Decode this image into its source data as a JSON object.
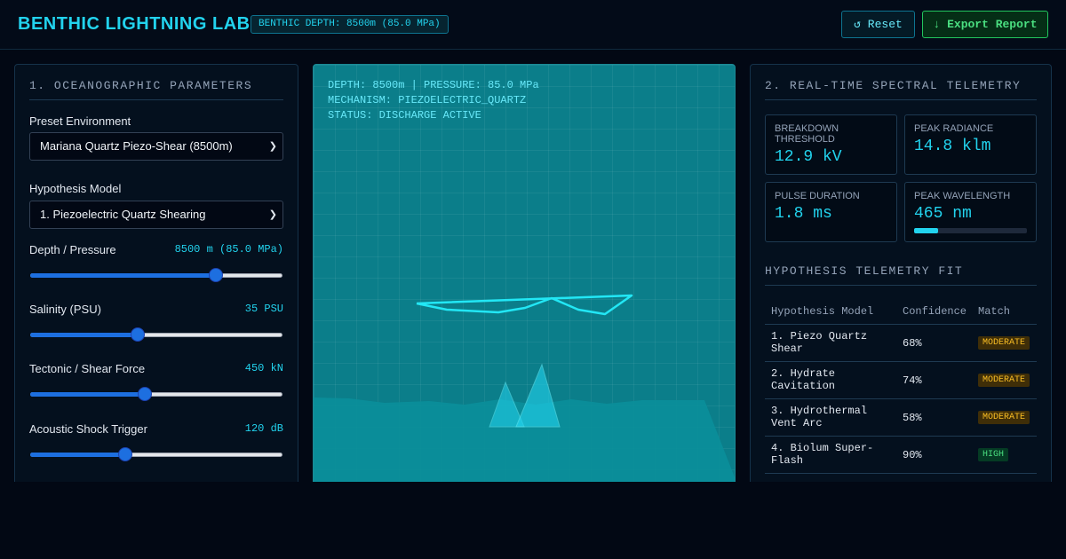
{
  "header": {
    "title": "BENTHIC LIGHTNING LAB",
    "depth_badge": "BENTHIC DEPTH: 8500m (85.0 MPa)",
    "reset_label": "↺ Reset",
    "export_label": "↓ Export Report"
  },
  "left_panel": {
    "heading": "1. OCEANOGRAPHIC PARAMETERS",
    "preset_label": "Preset Environment",
    "preset_value": "Mariana Quartz Piezo-Shear (8500m)",
    "hypothesis_label": "Hypothesis Model",
    "hypothesis_value": "1. Piezoelectric Quartz Shearing",
    "sliders": [
      {
        "label": "Depth / Pressure",
        "value_text": "8500 m (85.0 MPa)",
        "level": 0.75
      },
      {
        "label": "Salinity (PSU)",
        "value_text": "35 PSU",
        "level": 0.42
      },
      {
        "label": "Tectonic / Shear Force",
        "value_text": "450 kN",
        "level": 0.45
      },
      {
        "label": "Acoustic Shock Trigger",
        "value_text": "120 dB",
        "level": 0.37
      }
    ]
  },
  "viz": {
    "line1": "DEPTH: 8500m | PRESSURE: 85.0 MPa",
    "line2": "MECHANISM: PIEZOELECTRIC_QUARTZ",
    "line3": "STATUS: DISCHARGE ACTIVE"
  },
  "right_panel": {
    "heading": "2. REAL-TIME SPECTRAL TELEMETRY",
    "metrics": [
      {
        "label": "BREAKDOWN THRESHOLD",
        "value": "12.9 kV"
      },
      {
        "label": "PEAK RADIANCE",
        "value": "14.8 klm"
      },
      {
        "label": "PULSE DURATION",
        "value": "1.8 ms"
      },
      {
        "label": "PEAK WAVELENGTH",
        "value": "465 nm"
      }
    ],
    "wavelength_level": 0.21,
    "table_heading": "HYPOTHESIS TELEMETRY FIT",
    "columns": [
      "Hypothesis Model",
      "Confidence",
      "Match"
    ],
    "rows": [
      {
        "model": "1. Piezo Quartz Shear",
        "confidence": "68%",
        "match": "MODERATE"
      },
      {
        "model": "2. Hydrate Cavitation",
        "confidence": "74%",
        "match": "MODERATE"
      },
      {
        "model": "3. Hydrothermal Vent Arc",
        "confidence": "58%",
        "match": "MODERATE"
      },
      {
        "model": "4. Biolum Super-Flash",
        "confidence": "90%",
        "match": "HIGH"
      }
    ]
  },
  "colors": {
    "accent": "#22d3ee",
    "export_green": "#4ade80",
    "moderate": "#fbbf24",
    "high": "#4ade80",
    "viz_bg": "#0b7e8a"
  }
}
